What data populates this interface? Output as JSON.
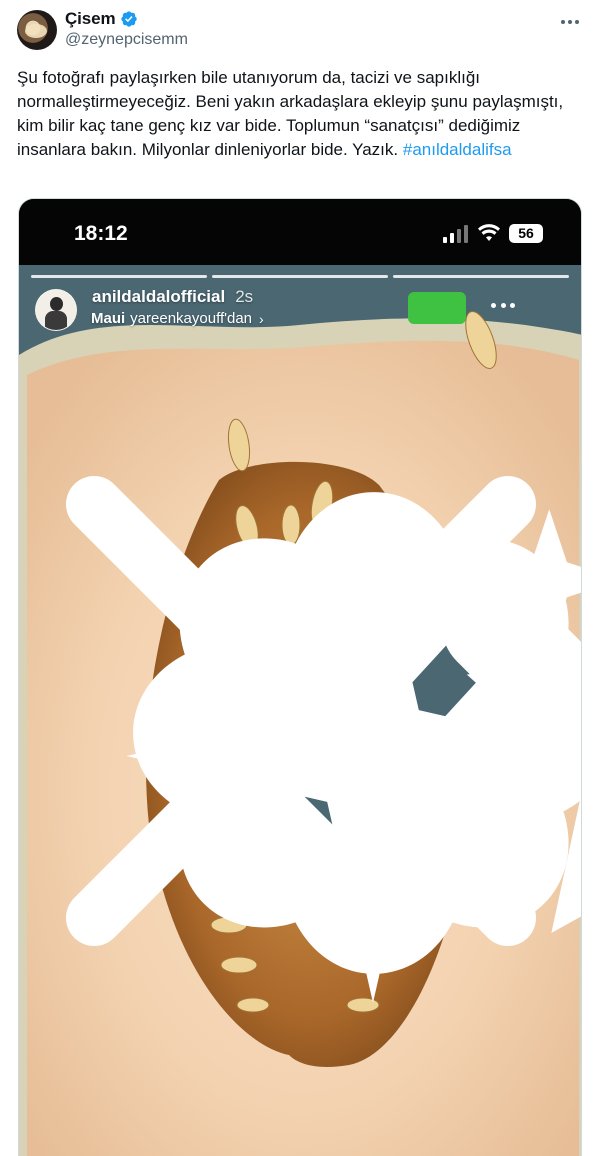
{
  "tweet": {
    "author_name": "Çisem",
    "author_handle": "@zeynepcisemm",
    "text": "Şu fotoğrafı paylaşırken bile utanıyorum da, tacizi ve sapıklığı normalleştirmeyeceğiz. Beni yakın arkadaşlara ekleyip şunu paylaşmıştı, kim bilir kaç tane genç kız var bide. Toplumun “sanatçısı” dediğimiz insanlara bakın. Milyonlar dinleniyorlar bide. Yazık.",
    "hashtag": "#anıldaldalifsa",
    "colors": {
      "link": "#1d9bf0",
      "verified": "#1d9bf0",
      "secondary_text": "#536471"
    }
  },
  "story": {
    "clock": "18:12",
    "battery": "56",
    "username": "anildaldalofficial",
    "time_ago": "2s",
    "music_song": "Maui",
    "music_artist": "yareenkayouff'dan",
    "progress_segments": [
      1.0,
      1.0,
      1.0
    ],
    "close_friends_color": "#3fc142",
    "icons": [
      "signal-icon",
      "wifi-icon",
      "star-icon",
      "chevron-down-icon",
      "more-icon",
      "close-icon",
      "sparkle-icon",
      "verified-icon"
    ]
  }
}
